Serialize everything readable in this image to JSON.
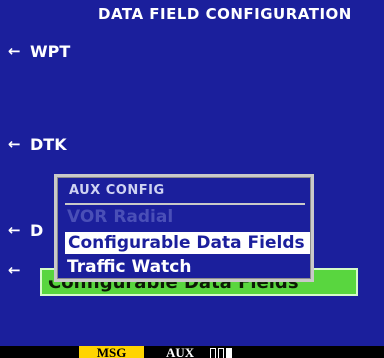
{
  "screen": {
    "title": "DATA FIELD CONFIGURATION",
    "fields": [
      {
        "arrow": "←",
        "label": "WPT"
      },
      {
        "arrow": "←",
        "label": "DTK"
      },
      {
        "arrow": "←",
        "label": "D"
      },
      {
        "arrow": "←",
        "label": ""
      }
    ],
    "highlighted_field": "Configurable Data Fields"
  },
  "aux_config": {
    "title": "AUX CONFIG",
    "items": [
      {
        "label": "VOR Radial",
        "state": "disabled"
      },
      {
        "label": "Configurable Data Fields",
        "state": "selected"
      },
      {
        "label": "Traffic Watch",
        "state": "normal"
      }
    ]
  },
  "status_bar": {
    "msg": "MSG",
    "page_group": "AUX",
    "page_indicator": {
      "total": 3,
      "active": 3
    }
  },
  "colors": {
    "background": "#1b1f9c",
    "highlight": "#59d63f",
    "msg": "#ffd400"
  }
}
